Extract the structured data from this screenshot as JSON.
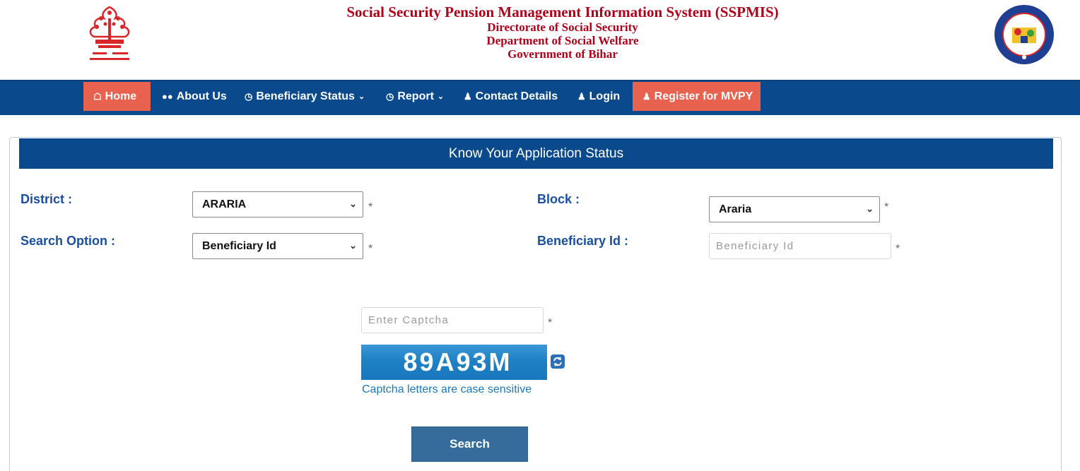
{
  "header": {
    "title": "Social Security Pension Management Information System (SSPMIS)",
    "line2": "Directorate of Social Security",
    "line3": "Department of Social Welfare",
    "line4": "Government of Bihar",
    "logo_left_icon": "bihar-govt-emblem-icon",
    "logo_right_icon": "department-seal-icon"
  },
  "nav": {
    "items": [
      {
        "label": "Home",
        "icon": "home-icon"
      },
      {
        "label": "About Us",
        "icon": "users-icon"
      },
      {
        "label": "Beneficiary Status",
        "icon": "clock-icon"
      },
      {
        "label": "Report",
        "icon": "clock-icon"
      },
      {
        "label": "Contact Details",
        "icon": "user-icon"
      },
      {
        "label": "Login",
        "icon": "user-icon"
      },
      {
        "label": "Register for MVPY",
        "icon": "user-icon"
      }
    ],
    "active_color": "#e8624f",
    "bar_color": "#0a4a8c"
  },
  "form": {
    "heading": "Know Your Application Status",
    "district_label": "District   :",
    "district_value": "ARARIA",
    "block_label": "Block  :",
    "block_value": "Araria",
    "search_option_label": "Search Option  :",
    "search_option_value": "Beneficiary Id",
    "beneficiary_id_label": "Beneficiary Id :",
    "beneficiary_id_placeholder": "Beneficiary Id",
    "captcha_placeholder": "Enter Captcha",
    "captcha_code": "89A93M",
    "captcha_hint": "Captcha letters are case sensitive",
    "search_button": "Search",
    "required_mark": "*"
  }
}
